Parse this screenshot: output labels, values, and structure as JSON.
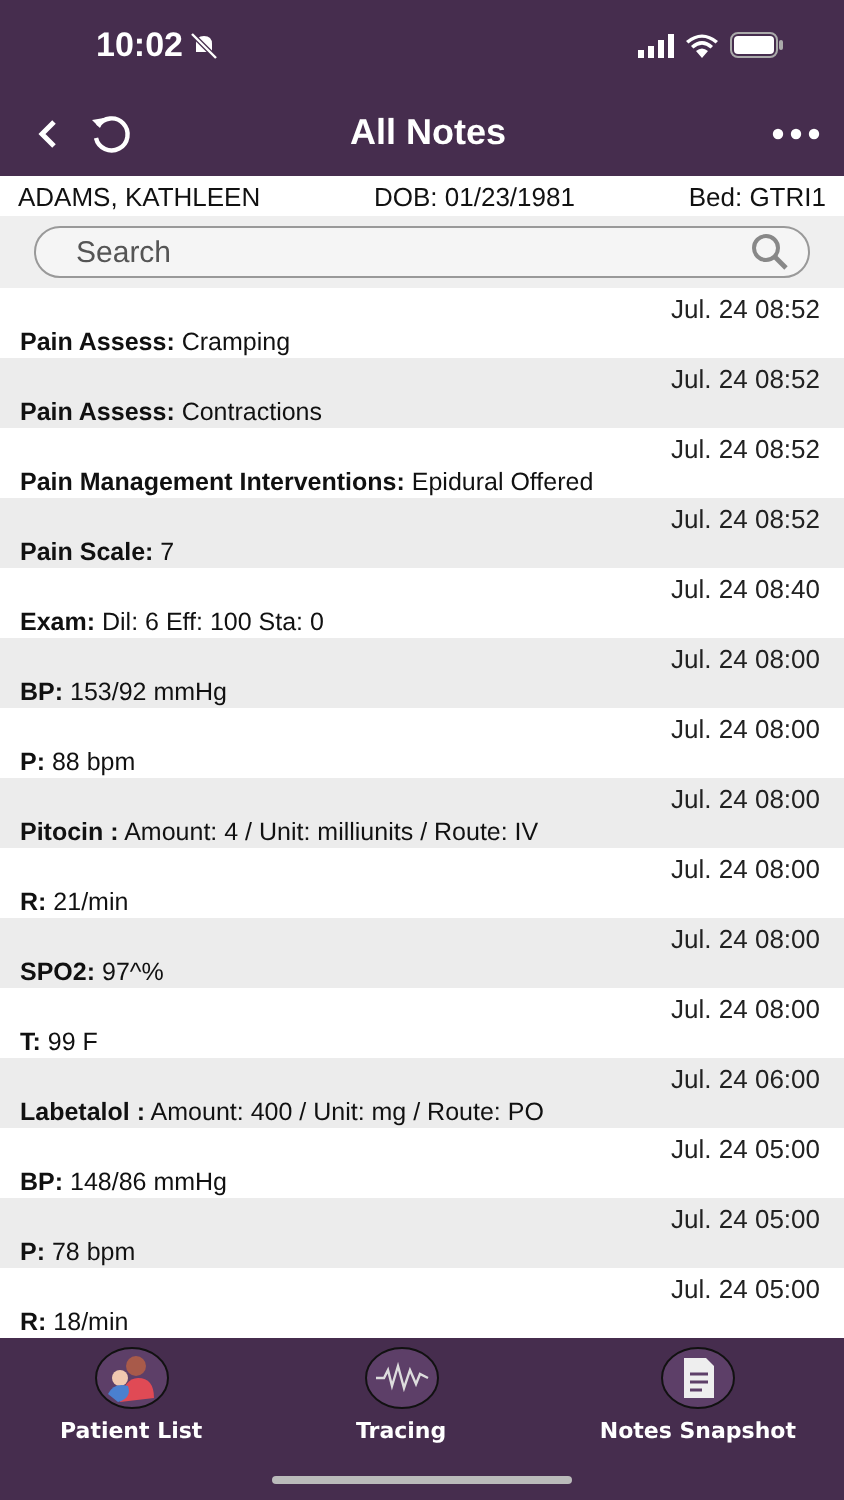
{
  "status_bar": {
    "time": "10:02"
  },
  "nav": {
    "title": "All Notes"
  },
  "patient": {
    "name": "ADAMS, KATHLEEN",
    "dob": "DOB: 01/23/1981",
    "bed": "Bed: GTRI1"
  },
  "search": {
    "placeholder": "Search"
  },
  "notes": [
    {
      "time": "Jul. 24 08:52",
      "text": "**Pain Assess:** Cramping"
    },
    {
      "time": "Jul. 24 08:52",
      "text": "**Pain Assess:** Contractions"
    },
    {
      "time": "Jul. 24 08:52",
      "text": "**Pain Management Interventions:** Epidural Offered"
    },
    {
      "time": "Jul. 24 08:52",
      "text": "**Pain Scale:** 7"
    },
    {
      "time": "Jul. 24 08:40",
      "text": "**Exam:** Dil: 6 Eff: 100 Sta: 0"
    },
    {
      "time": "Jul. 24 08:00",
      "text": "**BP:** 153/92 mmHg"
    },
    {
      "time": "Jul. 24 08:00",
      "text": "**P:** 88 bpm"
    },
    {
      "time": "Jul. 24 08:00",
      "text": "**Pitocin :** Amount: 4 / Unit: milliunits / Route: IV"
    },
    {
      "time": "Jul. 24 08:00",
      "text": "**R:** 21/min"
    },
    {
      "time": "Jul. 24 08:00",
      "text": "**SPO2:** 97^%"
    },
    {
      "time": "Jul. 24 08:00",
      "text": "**T:** 99 F"
    },
    {
      "time": "Jul. 24 06:00",
      "text": "**Labetalol :**  Amount: 400 / Unit: mg / Route: PO"
    },
    {
      "time": "Jul. 24 05:00",
      "text": "**BP:** 148/86 mmHg"
    },
    {
      "time": "Jul. 24 05:00",
      "text": "**P:** 78 bpm"
    },
    {
      "time": "Jul. 24 05:00",
      "text": "**R:** 18/min"
    }
  ],
  "tab_bar": [
    {
      "kind": "patients",
      "label": "Patient List"
    },
    {
      "kind": "tracing",
      "label": "Tracing"
    },
    {
      "kind": "notes",
      "label": "Notes Snapshot"
    }
  ]
}
